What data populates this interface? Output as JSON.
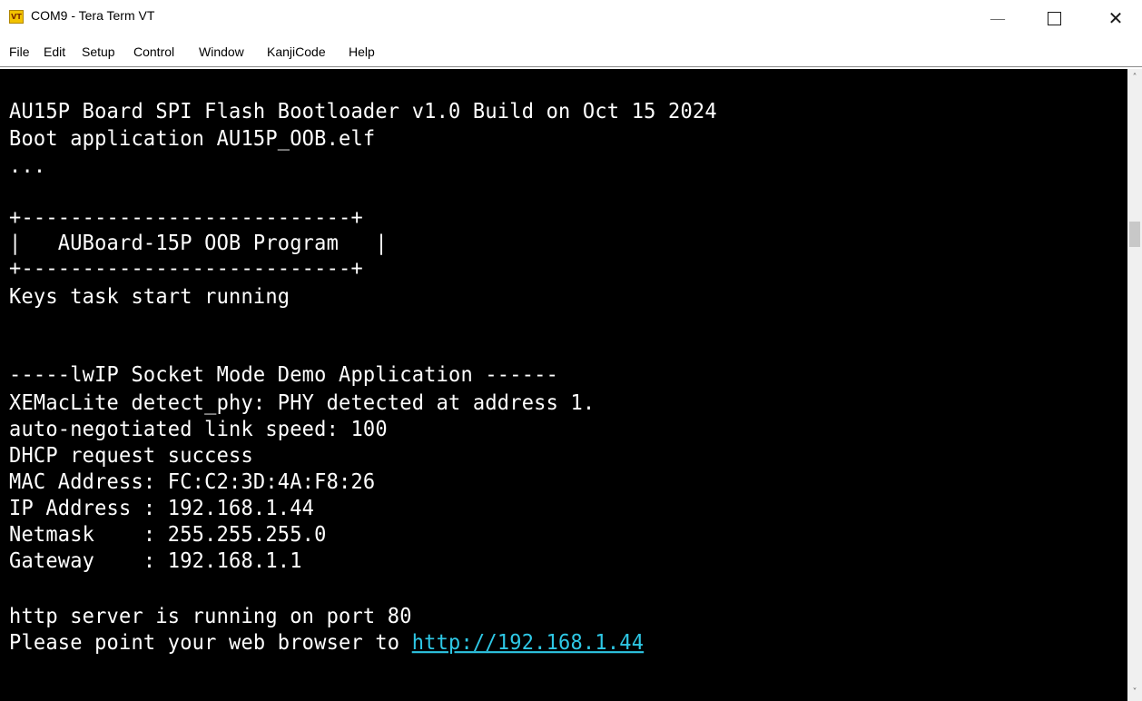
{
  "window": {
    "title": "COM9 - Tera Term VT",
    "icon_name": "tera-term-icon",
    "icon_text": "VT",
    "minimize_glyph": "—",
    "close_glyph": "✕"
  },
  "menu": {
    "items": [
      "File",
      "Edit",
      "Setup",
      "Control",
      "Window",
      "KanjiCode",
      "Help"
    ]
  },
  "terminal": {
    "colors": {
      "background": "#000000",
      "text": "#ffffff",
      "link": "#2ec8e6"
    },
    "lines": [
      "AU15P Board SPI Flash Bootloader v1.0 Build on Oct 15 2024",
      "Boot application AU15P_OOB.elf",
      "...",
      "",
      "+---------------------------+",
      "|   AUBoard-15P OOB Program   |",
      "+---------------------------+",
      "Keys task start running",
      "",
      "",
      "-----lwIP Socket Mode Demo Application ------",
      "XEMacLite detect_phy: PHY detected at address 1.",
      "auto-negotiated link speed: 100",
      "DHCP request success",
      "MAC Address: FC:C2:3D:4A:F8:26",
      "IP Address : 192.168.1.44",
      "Netmask    : 255.255.255.0",
      "Gateway    : 192.168.1.1",
      "",
      "http server is running on port 80",
      "Please point your web browser to "
    ],
    "link_text": "http://192.168.1.44"
  },
  "scrollbar": {
    "up_glyph": "˄",
    "down_glyph": "˅"
  }
}
